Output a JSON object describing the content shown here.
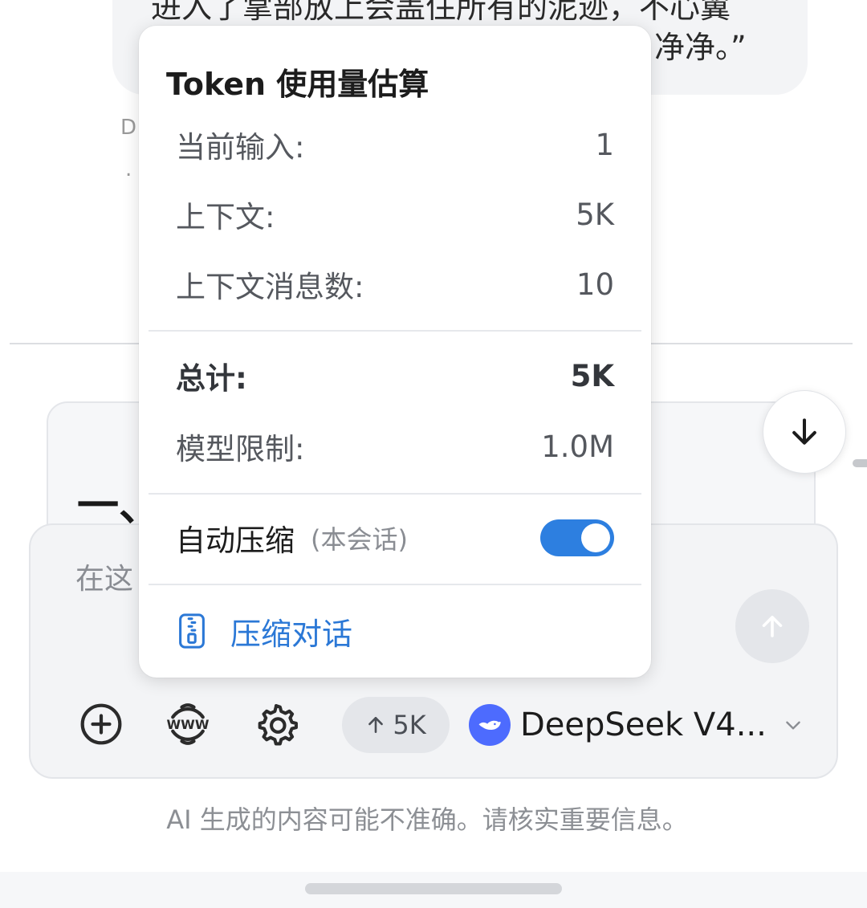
{
  "chat": {
    "message_line1": "进入了掌部放上会盖住所有的泥迹，不心翼",
    "message_line2": "净净。”",
    "meta_letter": "D",
    "meta_dot": ".",
    "preview_heading": "一、"
  },
  "token_popover": {
    "title": "Token 使用量估算",
    "rows": [
      {
        "label": "当前输入:",
        "value": "1"
      },
      {
        "label": "上下文:",
        "value": "5K"
      },
      {
        "label": "上下文消息数:",
        "value": "10"
      }
    ],
    "total": {
      "label": "总计:",
      "value": "5K"
    },
    "model_limit": {
      "label": "模型限制:",
      "value": "1.0M"
    },
    "auto_compress": {
      "label": "自动压缩",
      "sublabel": "(本会话)",
      "enabled": true
    },
    "compress_action": "压缩对话"
  },
  "composer": {
    "placeholder": "在这",
    "token_chip": "5K",
    "model_name": "DeepSeek V4...",
    "tools": [
      "add-icon",
      "web-search-icon",
      "settings-icon"
    ]
  },
  "disclaimer": "AI 生成的内容可能不准确。请核实重要信息。",
  "colors": {
    "accent": "#2d7fe0",
    "link": "#2b78d6",
    "model_logo": "#4d6bfe",
    "composer_bg": "#f3f4f6"
  }
}
